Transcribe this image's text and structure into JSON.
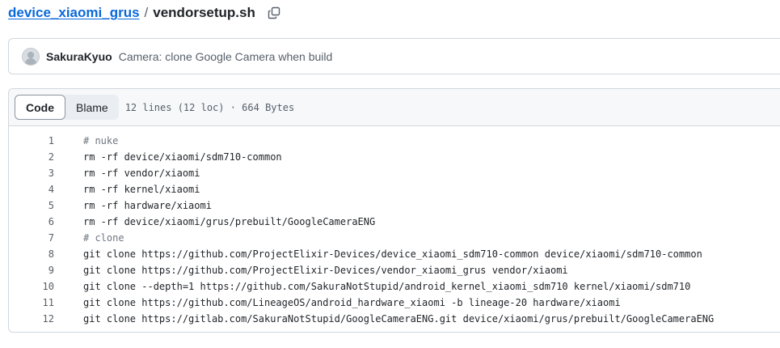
{
  "breadcrumb": {
    "repo": "device_xiaomi_grus",
    "separator": "/",
    "file": "vendorsetup.sh",
    "copy_icon": "copy-icon"
  },
  "commit": {
    "avatar_icon": "avatar",
    "author": "SakuraKyuo",
    "message": "Camera: clone Google Camera when build"
  },
  "file_header": {
    "tabs": [
      {
        "label": "Code",
        "active": true
      },
      {
        "label": "Blame",
        "active": false
      }
    ],
    "info": "12 lines (12 loc) · 664 Bytes"
  },
  "code": {
    "lines": [
      {
        "n": "1",
        "text": "# nuke",
        "comment": true
      },
      {
        "n": "2",
        "text": "rm -rf device/xiaomi/sdm710-common",
        "comment": false
      },
      {
        "n": "3",
        "text": "rm -rf vendor/xiaomi",
        "comment": false
      },
      {
        "n": "4",
        "text": "rm -rf kernel/xiaomi",
        "comment": false
      },
      {
        "n": "5",
        "text": "rm -rf hardware/xiaomi",
        "comment": false
      },
      {
        "n": "6",
        "text": "rm -rf device/xiaomi/grus/prebuilt/GoogleCameraENG",
        "comment": false
      },
      {
        "n": "7",
        "text": "# clone",
        "comment": true
      },
      {
        "n": "8",
        "text": "git clone https://github.com/ProjectElixir-Devices/device_xiaomi_sdm710-common device/xiaomi/sdm710-common",
        "comment": false
      },
      {
        "n": "9",
        "text": "git clone https://github.com/ProjectElixir-Devices/vendor_xiaomi_grus vendor/xiaomi",
        "comment": false
      },
      {
        "n": "10",
        "text": "git clone --depth=1 https://github.com/SakuraNotStupid/android_kernel_xiaomi_sdm710 kernel/xiaomi/sdm710",
        "comment": false
      },
      {
        "n": "11",
        "text": "git clone https://github.com/LineageOS/android_hardware_xiaomi -b lineage-20 hardware/xiaomi",
        "comment": false
      },
      {
        "n": "12",
        "text": "git clone https://gitlab.com/SakuraNotStupid/GoogleCameraENG.git device/xiaomi/grus/prebuilt/GoogleCameraENG",
        "comment": false
      }
    ]
  }
}
